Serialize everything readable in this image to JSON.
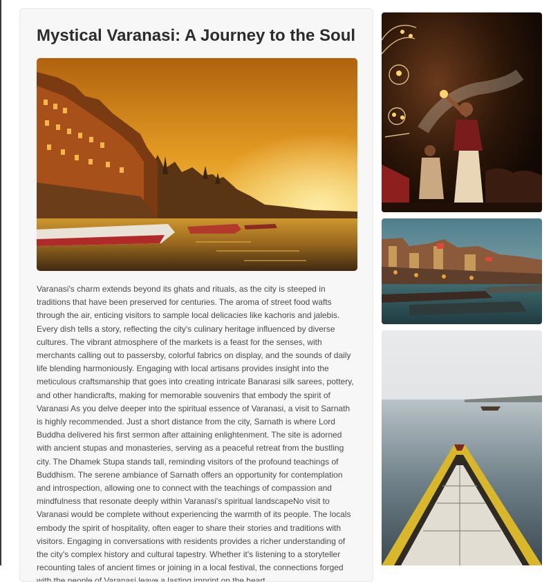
{
  "article": {
    "title": "Mystical Varanasi: A Journey to the Soul",
    "body": "Varanasi's charm extends beyond its ghats and rituals, as the city is steeped in traditions that have been preserved for centuries. The aroma of street food wafts through the air, enticing visitors to sample local delicacies like kachoris and jalebis. Every dish tells a story, reflecting the city's culinary heritage influenced by diverse cultures. The vibrant atmosphere of the markets is a feast for the senses, with merchants calling out to passersby, colorful fabrics on display, and the sounds of daily life blending harmoniously. Engaging with local artisans provides insight into the meticulous craftsmanship that goes into creating intricate Banarasi silk sarees, pottery, and other handicrafts, making for memorable souvenirs that embody the spirit of Varanasi As you delve deeper into the spiritual essence of Varanasi, a visit to Sarnath is highly recommended. Just a short distance from the city, Sarnath is where Lord Buddha delivered his first sermon after attaining enlightenment. The site is adorned with ancient stupas and monasteries, serving as a peaceful retreat from the bustling city. The Dhamek Stupa stands tall, reminding visitors of the profound teachings of Buddhism. The serene ambiance of Sarnath offers an opportunity for contemplation and introspection, allowing one to connect with the teachings of compassion and mindfulness that resonate deeply within Varanasi's spiritual landscapeNo visit to Varanasi would be complete without experiencing the warmth of its people. The locals embody the spirit of hospitality, often eager to share their stories and traditions with visitors. Engaging in conversations with residents provides a richer understanding of the city's complex history and cultural tapestry. Whether it's listening to a storyteller recounting tales of ancient times or joining in a local festival, the connections forged with the people of Varanasi leave a lasting imprint on the heart."
  },
  "colors": {
    "card_background": "#f7f7f7",
    "title": "#2c2c2c",
    "body_text": "#4a4a4a"
  }
}
